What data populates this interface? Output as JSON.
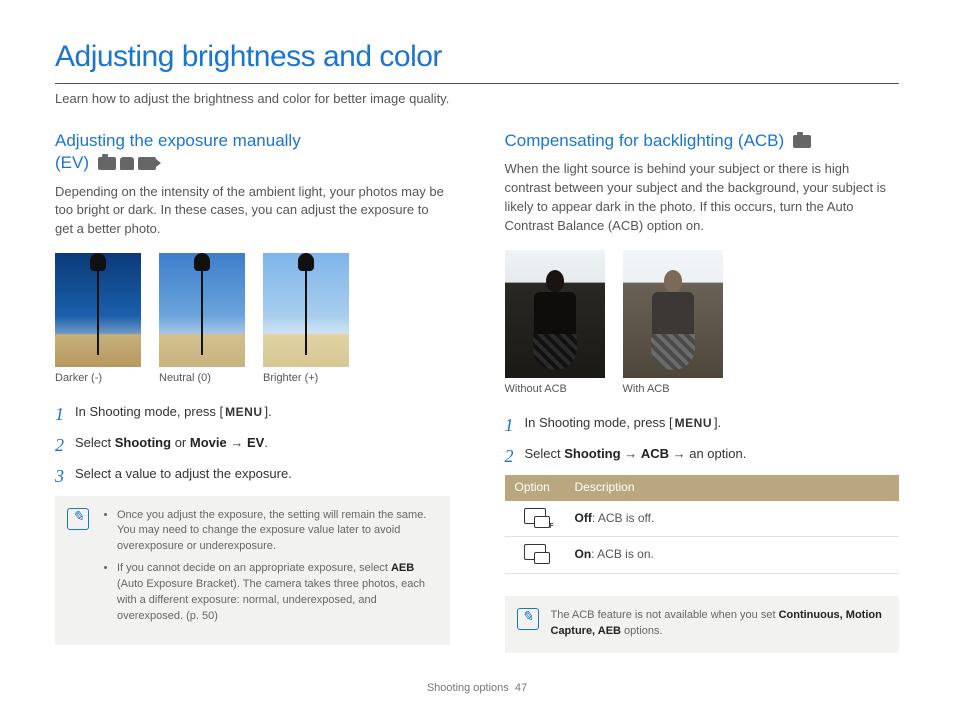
{
  "title": "Adjusting brightness and color",
  "lead": "Learn how to adjust the brightness and color for better image quality.",
  "left": {
    "heading_l1": "Adjusting the exposure manually",
    "heading_l2": "(EV)",
    "intro": "Depending on the intensity of the ambient light, your photos may be too bright or dark. In these cases, you can adjust the exposure to get a better photo.",
    "captions": {
      "a": "Darker (-)",
      "b": "Neutral (0)",
      "c": "Brighter (+)"
    },
    "steps": {
      "s1a": "In Shooting mode, press [",
      "menu": "MENU",
      "s1b": "].",
      "s2a": "Select ",
      "s2b": "Shooting",
      "s2c": " or ",
      "s2d": "Movie",
      "s2e": " → ",
      "s2f": "EV",
      "s2g": ".",
      "s3": "Select a value to adjust the exposure."
    },
    "notes": {
      "n1": "Once you adjust the exposure, the setting will remain the same. You may need to change the exposure value later to avoid overexposure or underexposure.",
      "n2a": "If you cannot decide on an appropriate exposure, select ",
      "n2b": "AEB",
      "n2c": " (Auto Exposure Bracket). The camera takes three photos, each with a different exposure: normal, underexposed, and overexposed. (p. 50)"
    }
  },
  "right": {
    "heading": "Compensating for backlighting (ACB)",
    "intro": "When the light source is behind your subject or there is high contrast between your subject and the background, your subject is likely to appear dark in the photo. If this occurs, turn the Auto Contrast Balance (ACB) option on.",
    "captions": {
      "a": "Without ACB",
      "b": "With ACB"
    },
    "steps": {
      "s1a": "In Shooting mode, press [",
      "menu": "MENU",
      "s1b": "].",
      "s2a": "Select ",
      "s2b": "Shooting",
      "s2c": " → ",
      "s2d": "ACB",
      "s2e": " → an option."
    },
    "table": {
      "h1": "Option",
      "h2": "Description",
      "r1a": "Off",
      "r1b": ": ACB is off.",
      "r2a": "On",
      "r2b": ": ACB is on."
    },
    "note_a": "The ACB feature is not available when you set ",
    "note_b": "Continuous, Motion Capture, AEB",
    "note_c": " options."
  },
  "footer": {
    "section": "Shooting options",
    "page": "47"
  }
}
